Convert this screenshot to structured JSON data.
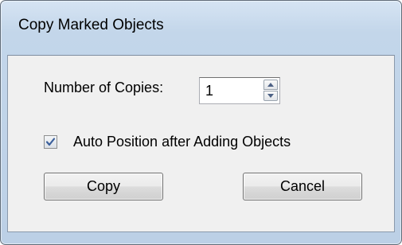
{
  "window": {
    "title": "Copy Marked Objects"
  },
  "form": {
    "copies_label": "Number of Copies:",
    "copies_value": "1",
    "auto_position_label": "Auto Position after Adding Objects",
    "auto_position_checked": true
  },
  "buttons": {
    "copy_label": "Copy",
    "cancel_label": "Cancel"
  },
  "icons": {
    "spin_up": "up-arrow-icon",
    "spin_down": "down-arrow-icon",
    "checkmark": "checkmark-icon"
  },
  "colors": {
    "frame": "#c3d6ea",
    "client": "#f0f0f0",
    "check": "#3b5f9b"
  }
}
